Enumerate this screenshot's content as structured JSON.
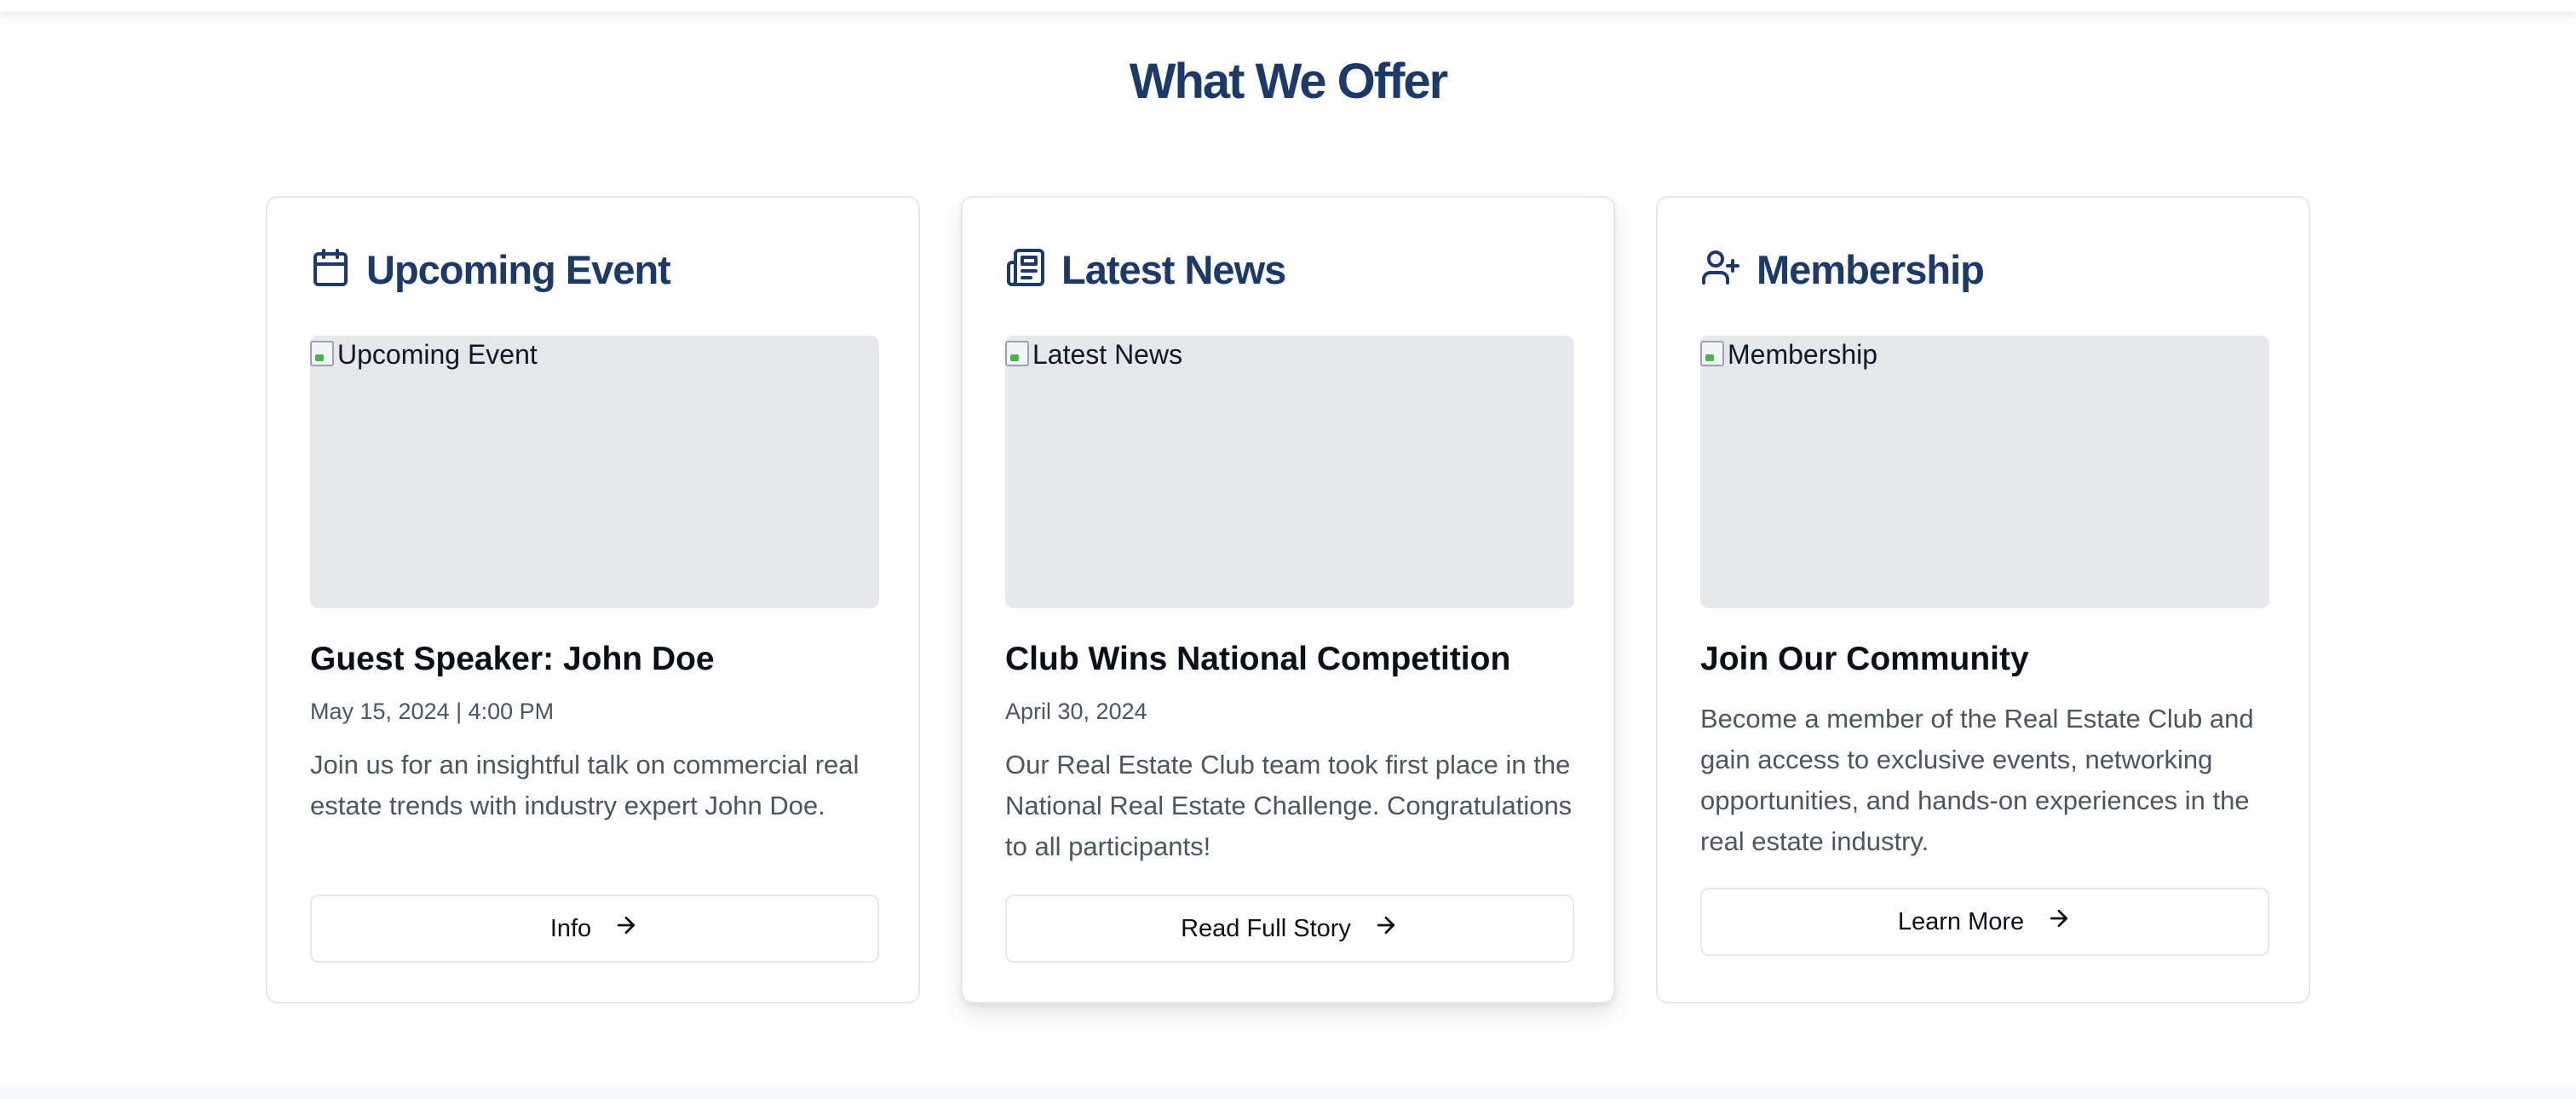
{
  "section": {
    "title": "What We Offer"
  },
  "colors": {
    "heading": "#1b3a6b",
    "muted": "#4b5563",
    "image_placeholder": "#e5e7eb",
    "border": "#e5e7eb"
  },
  "cards": [
    {
      "icon": "calendar-icon",
      "title": "Upcoming Event",
      "image_alt": "Upcoming Event",
      "subtitle": "Guest Speaker: John Doe",
      "date": "May 15, 2024 | 4:00 PM",
      "description": "Join us for an insightful talk on commercial real estate trends with industry expert John Doe.",
      "button_label": "Info"
    },
    {
      "icon": "newspaper-icon",
      "title": "Latest News",
      "image_alt": "Latest News",
      "subtitle": "Club Wins National Competition",
      "date": "April 30, 2024",
      "description": "Our Real Estate Club team took first place in the National Real Estate Challenge. Congratulations to all participants!",
      "button_label": "Read Full Story"
    },
    {
      "icon": "user-plus-icon",
      "title": "Membership",
      "image_alt": "Membership",
      "subtitle": "Join Our Community",
      "description": "Become a member of the Real Estate Club and gain access to exclusive events, networking opportunities, and hands-on experiences in the real estate industry.",
      "button_label": "Learn More"
    }
  ]
}
